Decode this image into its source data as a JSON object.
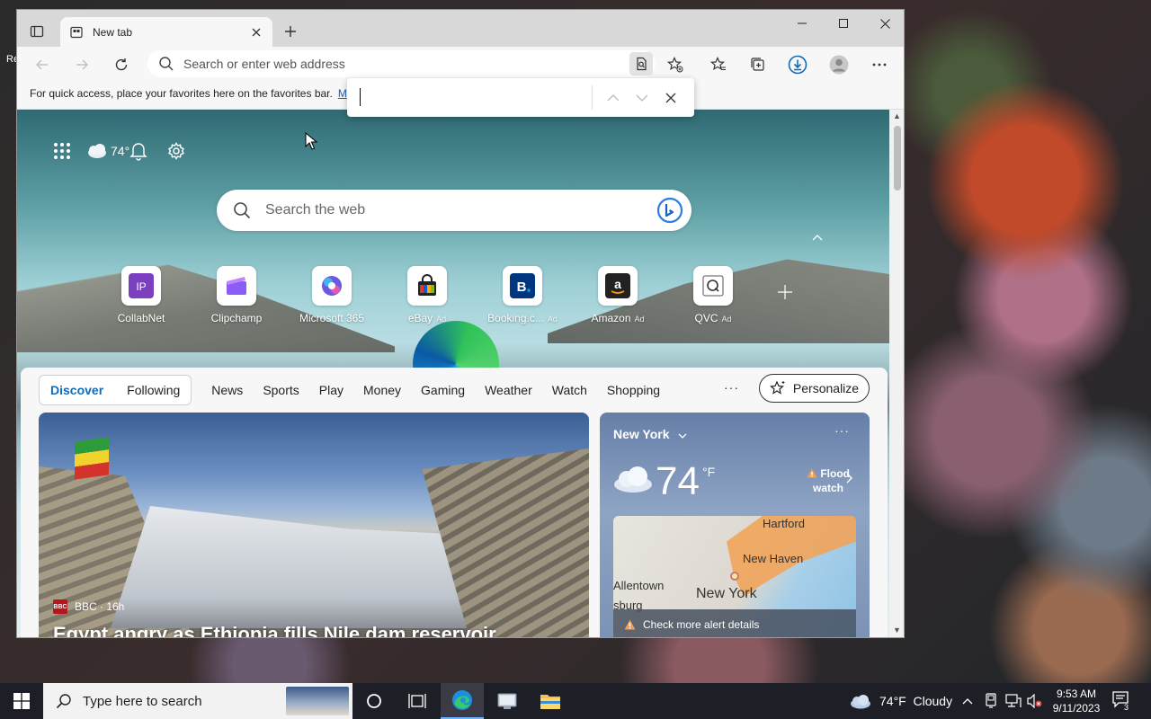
{
  "desktop": {
    "icon_label": "Re"
  },
  "browser": {
    "tab": {
      "title": "New tab"
    },
    "address": {
      "placeholder": "Search or enter web address"
    },
    "favbar": {
      "text": "For quick access, place your favorites here on the favorites bar.",
      "link": "M"
    }
  },
  "ntp": {
    "weather_temp": "74°",
    "search_placeholder": "Search the web",
    "quicklinks": [
      {
        "label": "CollabNet",
        "ad": ""
      },
      {
        "label": "Clipchamp",
        "ad": ""
      },
      {
        "label": "Microsoft 365",
        "ad": ""
      },
      {
        "label": "eBay",
        "ad": "Ad"
      },
      {
        "label": "Booking.c...",
        "ad": "Ad"
      },
      {
        "label": "Amazon",
        "ad": "Ad"
      },
      {
        "label": "QVC",
        "ad": "Ad"
      }
    ],
    "feed_tabs": {
      "discover": "Discover",
      "following": "Following"
    },
    "nav": [
      "News",
      "Sports",
      "Play",
      "Money",
      "Gaming",
      "Weather",
      "Watch",
      "Shopping"
    ],
    "more": "···",
    "personalize": "Personalize",
    "hero": {
      "source": "BBC · 16h",
      "source_logo": "BBC",
      "title": "Egypt angry as Ethiopia fills Nile dam reservoir"
    },
    "weather_card": {
      "location": "New York",
      "temp": "74",
      "unit": "°F",
      "alert": "Flood watch",
      "cities": {
        "hartford": "Hartford",
        "newhaven": "New Haven",
        "allentown": "Allentown",
        "burg": "sburg",
        "newyork": "New York"
      },
      "alert_bar": "Check more alert details",
      "more": "···"
    }
  },
  "taskbar": {
    "search_placeholder": "Type here to search",
    "weather": "74°F  Cloudy",
    "time": "9:53 AM",
    "date": "9/11/2023",
    "notif_count": "3"
  },
  "colors": {
    "accent": "#0f6cbd",
    "taskbar": "#1e1f26"
  }
}
